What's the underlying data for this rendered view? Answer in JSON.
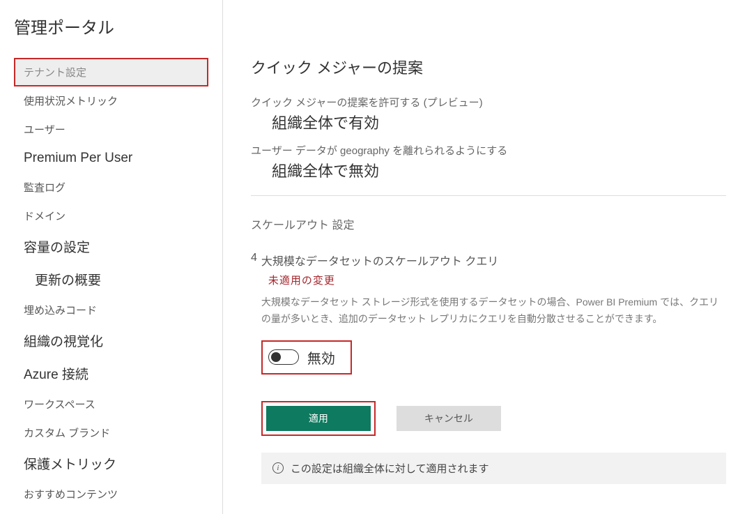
{
  "sidebar": {
    "title": "管理ポータル",
    "items": [
      {
        "label": "テナント設定"
      },
      {
        "label": "使用状況メトリック"
      },
      {
        "label": "ユーザー"
      },
      {
        "label": "Premium Per User"
      },
      {
        "label": "監査ログ"
      },
      {
        "label": "ドメイン"
      },
      {
        "label": "容量の設定"
      },
      {
        "label": "更新の概要"
      },
      {
        "label": "埋め込みコード"
      },
      {
        "label": "組織の視覚化"
      },
      {
        "label": "Azure 接続"
      },
      {
        "label": "ワークスペース"
      },
      {
        "label": "カスタム ブランド"
      },
      {
        "label": "保護メトリック"
      },
      {
        "label": "おすすめコンテンツ"
      }
    ]
  },
  "main": {
    "section_title": "クイック メジャーの提案",
    "settings": [
      {
        "label": "クイック メジャーの提案を許可する (プレビュー)",
        "value": "組織全体で有効"
      },
      {
        "label": "ユーザー データが geography を離れられるようにする",
        "value": "組織全体で無効"
      }
    ],
    "scaleout": {
      "subsection": "スケールアウト 設定",
      "index": "4",
      "heading": "大規模なデータセットのスケールアウト クエリ",
      "warning": "未適用の変更",
      "description": "大規模なデータセット ストレージ形式を使用するデータセットの場合、Power BI Premium では、クエリの量が多いとき、追加のデータセット レプリカにクエリを自動分散させることができます。",
      "toggle_label": "無効"
    },
    "buttons": {
      "apply": "適用",
      "cancel": "キャンセル"
    },
    "info": "この設定は組織全体に対して適用されます"
  }
}
